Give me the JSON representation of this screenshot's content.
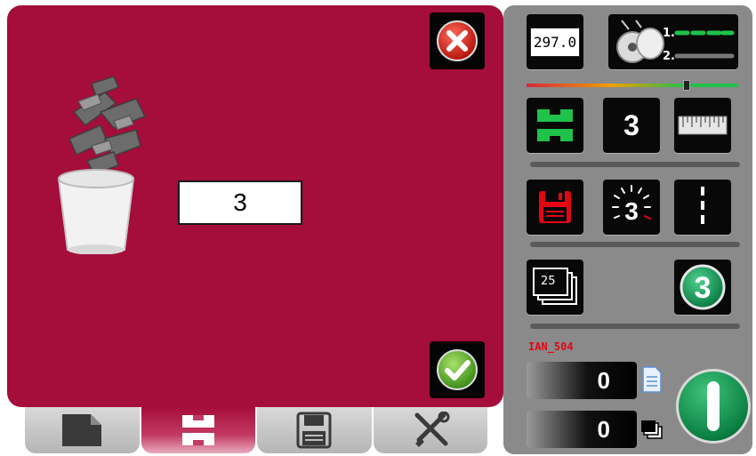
{
  "reject": {
    "count_value": "3"
  },
  "side": {
    "length_value": "297.0",
    "counter_value": "3",
    "batch_stack_value": "25",
    "job_name": "IAN_504",
    "sheets_counter": "0",
    "batches_counter": "0"
  },
  "icons": {
    "close": "close-x-icon",
    "confirm": "checkmark-icon",
    "trash": "trash-bin-icon",
    "roll_feed": "roll-feed-icon",
    "reject_tray": "reject-tray-icon",
    "ruler": "ruler-icon",
    "save": "floppy-disk-icon",
    "flash_count": "flash-count-icon",
    "cut_line": "cut-line-icon",
    "stack": "stack-icon",
    "badge": "number-badge-icon",
    "document": "document-icon",
    "start": "start-power-icon"
  },
  "colors": {
    "panel": "#a50d3b",
    "side_panel": "#8a8a8a",
    "accent_green": "#1fc24a",
    "alert_red": "#e30613"
  }
}
